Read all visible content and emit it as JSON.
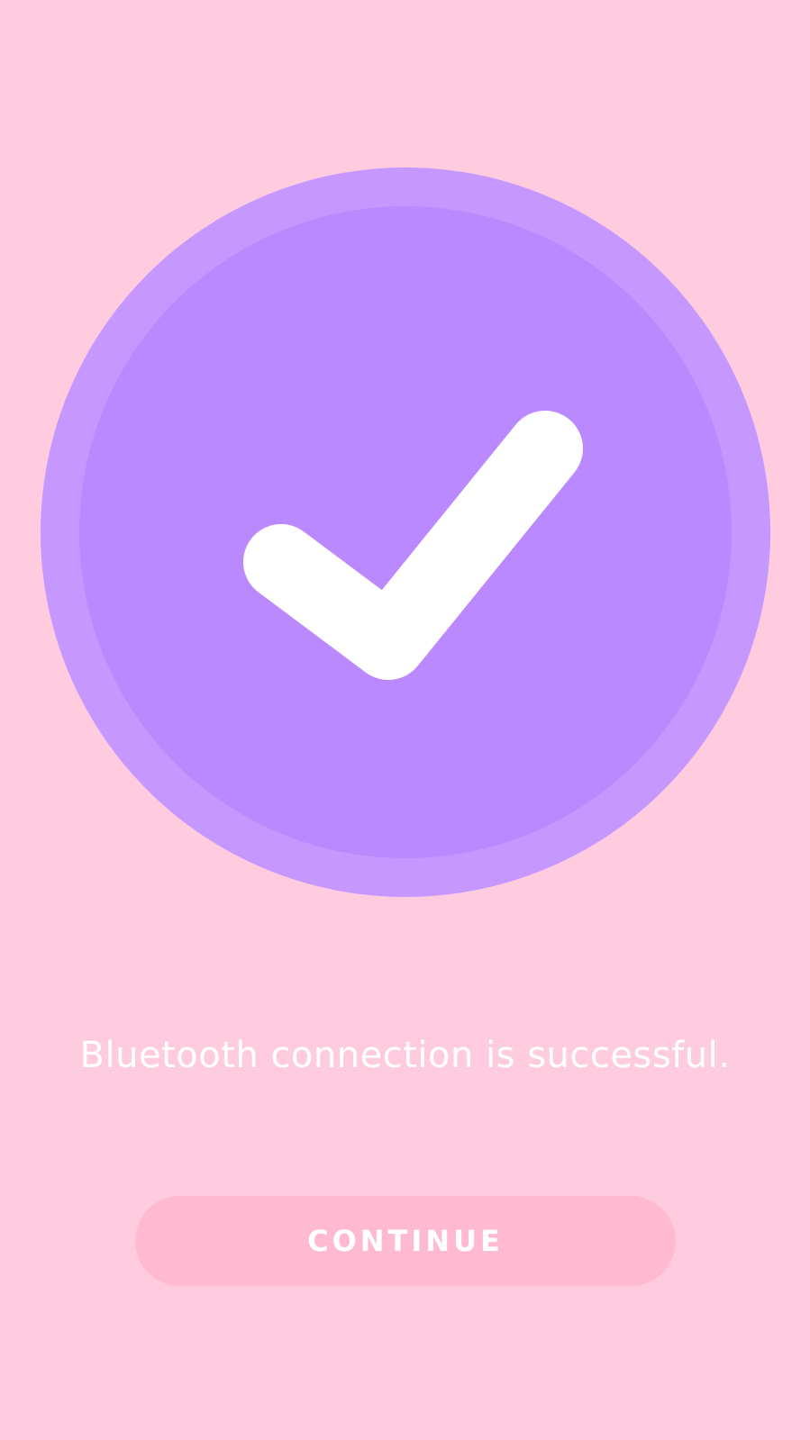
{
  "screen": {
    "message": "Bluetooth connection is successful.",
    "continue_label": "CONTINUE"
  },
  "icons": {
    "success": "check-icon"
  },
  "colors": {
    "background": "#FFCCDF",
    "badge_ring": "#C597FF",
    "badge_fill": "#BA89FF",
    "check": "#FFFFFF",
    "button": "#FFB9D1",
    "text": "#FFFFFF"
  }
}
